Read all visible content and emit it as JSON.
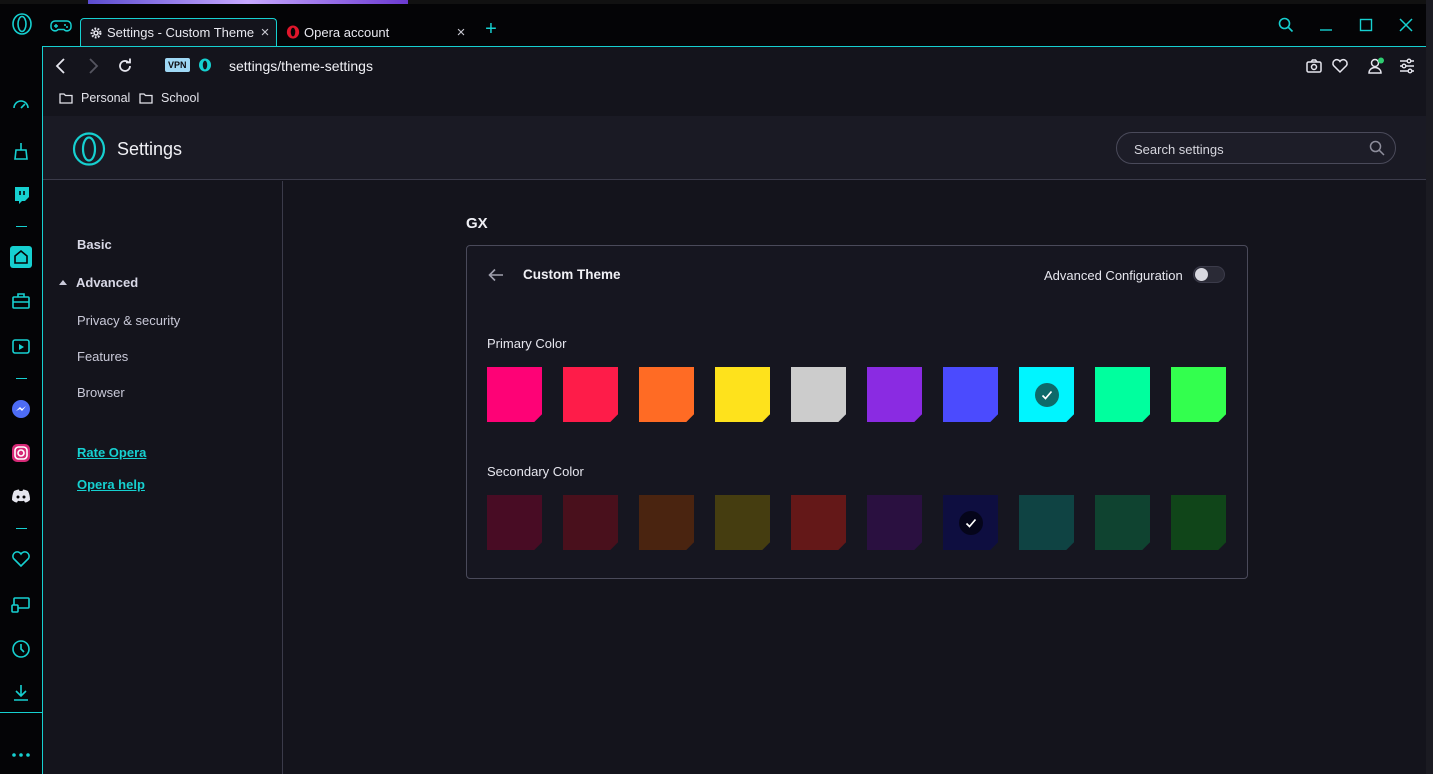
{
  "tabs": [
    {
      "title": "Settings - Custom Theme",
      "active": true,
      "close_glyph": "×"
    },
    {
      "title": "Opera account",
      "active": false,
      "close_glyph": "×"
    }
  ],
  "new_tab_glyph": "+",
  "address_bar": {
    "vpn_label": "VPN",
    "url": "settings/theme-settings"
  },
  "bookmarks": [
    {
      "label": "Personal",
      "icon": "folder-icon"
    },
    {
      "label": "School",
      "icon": "folder-icon"
    }
  ],
  "settings": {
    "title": "Settings",
    "search_placeholder": "Search settings",
    "nav": {
      "basic": "Basic",
      "advanced": "Advanced",
      "privacy": "Privacy & security",
      "features": "Features",
      "browser": "Browser",
      "rate": "Rate Opera",
      "help": "Opera help"
    },
    "section": "GX",
    "card": {
      "title": "Custom Theme",
      "advanced_config_label": "Advanced Configuration",
      "advanced_config_on": false,
      "primary_label": "Primary Color",
      "secondary_label": "Secondary Color"
    }
  },
  "primary_colors": [
    "#fe0276",
    "#fe1c49",
    "#ff6b24",
    "#fee21c",
    "#cccccc",
    "#8a2be2",
    "#4b4bfe",
    "#00f5ff",
    "#00ff9e",
    "#33ff4e"
  ],
  "primary_selected_index": 7,
  "secondary_colors": [
    "#480c24",
    "#49101c",
    "#4a2410",
    "#453d10",
    "#641818",
    "#2a1040",
    "#0e0e40",
    "#0f4343",
    "#0f4330",
    "#104519"
  ],
  "secondary_selected_index": 6,
  "accent_color": "#16d0d0"
}
